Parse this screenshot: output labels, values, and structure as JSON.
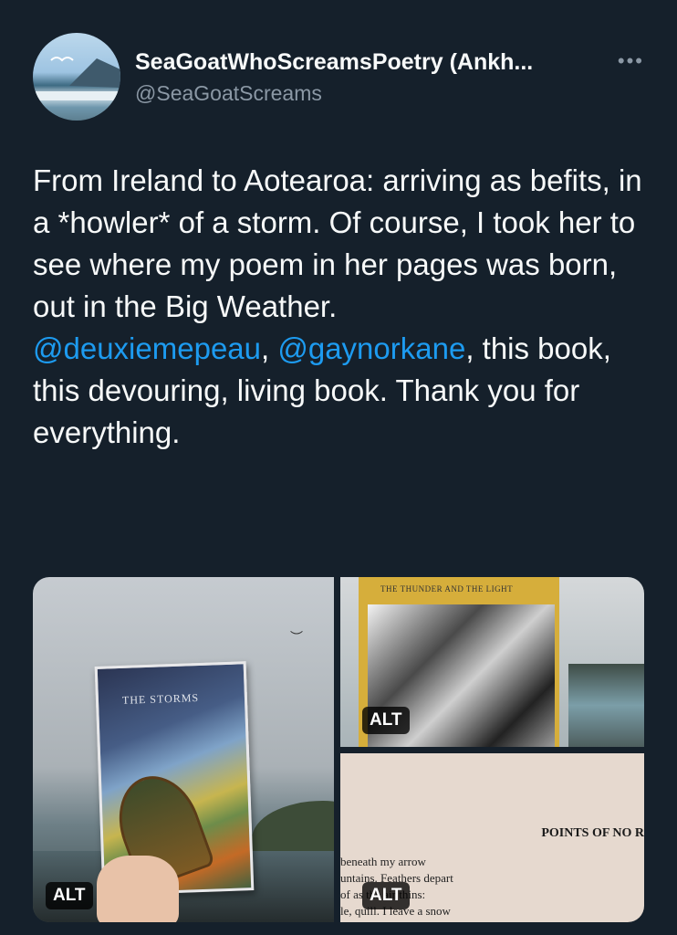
{
  "author": {
    "display_name": "SeaGoatWhoScreamsPoetry (Ankh...",
    "handle": "@SeaGoatScreams"
  },
  "more_icon": "more-horizontal-icon",
  "tweet": {
    "text_before": "From Ireland to Aotearoa: arriving as befits, in a *howler* of a storm. Of course, I took her to see where my poem in her pages was born, out in the Big Weather.",
    "mention1": "@deuxiemepeau",
    "separator": ", ",
    "mention2": "@gaynorkane",
    "text_after": ", this book, this devouring, living book. Thank you for everything."
  },
  "media": {
    "alt_label": "ALT",
    "photo1": {
      "book_title": "THE STORMS"
    },
    "photo2": {
      "book_title": "THE THUNDER AND THE LIGHT"
    },
    "photo3": {
      "heading": "POINTS OF NO R",
      "lines": [
        "beneath my arrow",
        "untains. Feathers depart",
        "of      as the air thins:",
        "le, quill. I leave a snow"
      ]
    }
  },
  "colors": {
    "background": "#15202b",
    "link": "#1d9bf0",
    "secondary": "#8b98a5"
  }
}
